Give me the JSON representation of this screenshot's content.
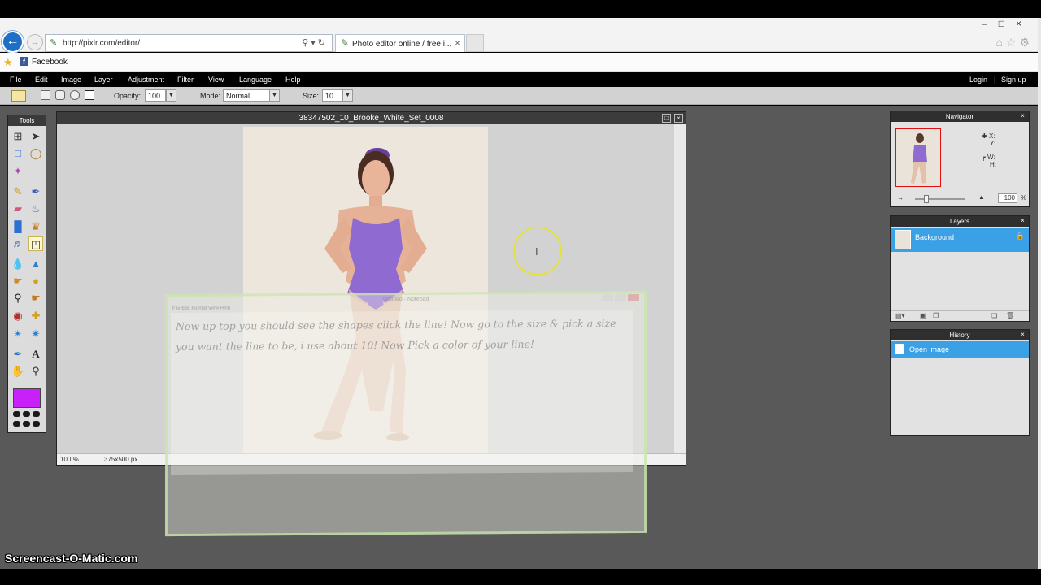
{
  "browser": {
    "url": "http://pixlr.com/editor/",
    "tab_title": "Photo editor online / free i...",
    "favorites": [
      {
        "label": "Facebook"
      }
    ]
  },
  "menu": {
    "items": [
      "File",
      "Edit",
      "Image",
      "Layer",
      "Adjustment",
      "Filter",
      "View",
      "Language",
      "Help"
    ],
    "login": "Login",
    "signup": "Sign up"
  },
  "options": {
    "opacity_label": "Opacity:",
    "opacity_value": "100",
    "mode_label": "Mode:",
    "mode_value": "Normal",
    "size_label": "Size:",
    "size_value": "10"
  },
  "tools_panel": {
    "title": "Tools",
    "foreground_color": "#c820f8",
    "icons": [
      "crop-icon",
      "move-icon",
      "marquee-icon",
      "lasso-icon",
      "magic-wand-icon",
      "pencil-icon",
      "brush-icon",
      "eraser-icon",
      "paint-bucket-icon",
      "gradient-icon",
      "clone-stamp-icon",
      "color-replace-icon",
      "shapes-icon",
      "blur-icon",
      "sharpen-icon",
      "smudge-icon",
      "sponge-icon",
      "dodge-icon",
      "burn-icon",
      "red-eye-icon",
      "spot-heal-icon",
      "bloat-icon",
      "pinch-icon",
      "color-picker-icon",
      "type-icon",
      "hand-icon",
      "zoom-icon"
    ]
  },
  "image_window": {
    "title": "38347502_10_Brooke_White_Set_0008",
    "zoom": "100 %",
    "dimensions": "375x500 px"
  },
  "notepad_overlay": {
    "title": "Untitled - Notepad",
    "menu": "File  Edit  Format  View  Help",
    "text": "Now up top you should see the shapes click the line! Now go to the size & pick a size you want the line to be, i use about 10! Now Pick a color of your line!"
  },
  "navigator": {
    "title": "Navigator",
    "x_label": "X:",
    "y_label": "Y:",
    "w_label": "W:",
    "h_label": "H:",
    "zoom_value": "100",
    "zoom_unit": "%"
  },
  "layers": {
    "title": "Layers",
    "items": [
      {
        "name": "Background",
        "locked": true
      }
    ]
  },
  "history": {
    "title": "History",
    "items": [
      {
        "name": "Open image"
      }
    ]
  },
  "watermark": "Screencast-O-Matic.com",
  "colors": {
    "accent": "#3aa1e6",
    "cursor_ring": "#e3e23d"
  }
}
